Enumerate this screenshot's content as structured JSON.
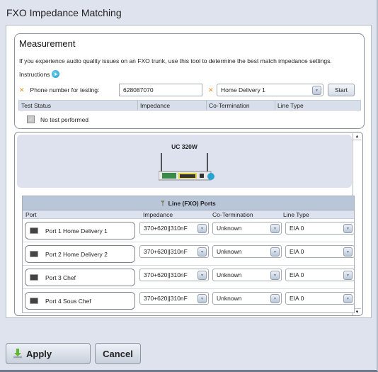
{
  "window": {
    "title": "FXO Impedance Matching"
  },
  "measurement": {
    "heading": "Measurement",
    "description": "If you experience audio quality issues on an FXO trunk, use this tool to determine the best match impedance settings.",
    "instructions_label": "Instructions",
    "phone_label": "Phone number for testing:",
    "phone_value": "628087070",
    "line_select": "Home Delivery 1",
    "start_label": "Start",
    "table_headers": [
      "Test Status",
      "Impedance",
      "Co-Termination",
      "Line Type"
    ],
    "status_text": "No test performed"
  },
  "device": {
    "name": "UC 320W"
  },
  "lines": {
    "heading": "Line (FXO) Ports",
    "columns": [
      "Port",
      "Impedance",
      "Co-Termination",
      "Line Type"
    ],
    "rows": [
      {
        "port": "Port 1 Home Delivery 1",
        "impedance": "370+620||310nF",
        "cotermination": "Unknown",
        "line_type": "EIA 0"
      },
      {
        "port": "Port 2 Home Delivery 2",
        "impedance": "370+620||310nF",
        "cotermination": "Unknown",
        "line_type": "EIA 0"
      },
      {
        "port": "Port 3 Chef",
        "impedance": "370+620||310nF",
        "cotermination": "Unknown",
        "line_type": "EIA 0"
      },
      {
        "port": "Port 4 Sous Chef",
        "impedance": "370+620||310nF",
        "cotermination": "Unknown",
        "line_type": "EIA 0"
      }
    ]
  },
  "footer": {
    "apply_label": "Apply",
    "cancel_label": "Cancel"
  }
}
